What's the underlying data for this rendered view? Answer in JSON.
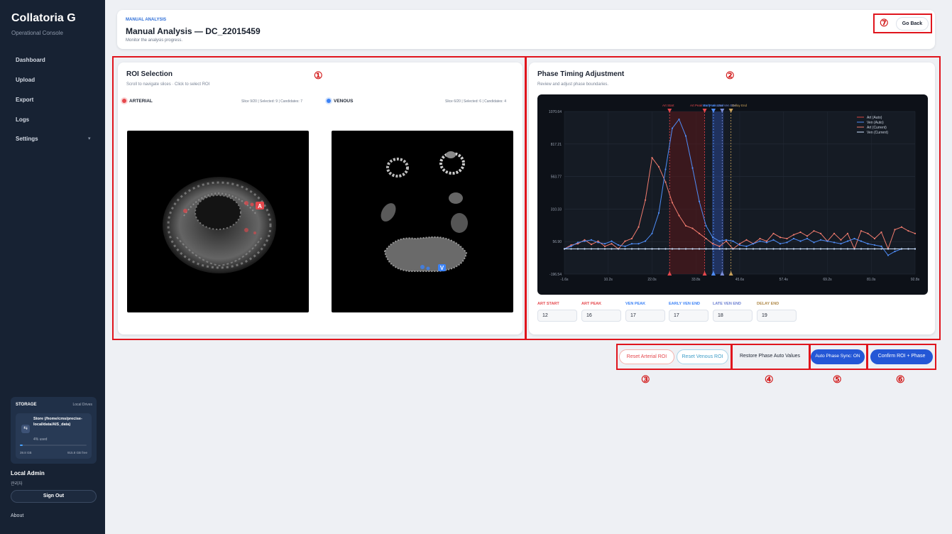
{
  "sidebar": {
    "brand": "Collatoria G",
    "subtitle": "Operational Console",
    "items": [
      {
        "label": "Dashboard"
      },
      {
        "label": "Upload"
      },
      {
        "label": "Export"
      },
      {
        "label": "Logs"
      },
      {
        "label": "Settings"
      }
    ],
    "storage": {
      "title": "STORAGE",
      "scope": "Local Drives",
      "name": "Store (/home/cms/precise-local/data/AIS_data)",
      "used_label": "4% used",
      "used_fraction": 0.04,
      "used": "39.8 GB",
      "free": "915.8 GB free"
    },
    "user": {
      "name": "Local Admin",
      "role": "관리자"
    },
    "sign_out": "Sign Out",
    "about": "About"
  },
  "header": {
    "eyebrow": "MANUAL ANALYSIS",
    "title": "Manual Analysis — DC_22015459",
    "subtitle": "Monitor the analysis progress.",
    "go_back": "Go Back"
  },
  "roi": {
    "title": "ROI Selection",
    "subtitle": "Scroll to navigate slices · Click to select ROI",
    "arterial": {
      "label": "ARTERIAL",
      "info": "Slice 9/20 | Selected: 9 | Candidates: 7",
      "marker": "A",
      "color": "#e5484d"
    },
    "venous": {
      "label": "VENOUS",
      "info": "Slice 6/20 | Selected: 6 | Candidates: 4",
      "marker": "V",
      "color": "#3b82f6"
    }
  },
  "phase": {
    "title": "Phase Timing Adjustment",
    "subtitle": "Review and adjust phase boundaries.",
    "fields": [
      {
        "label": "ART START",
        "value": "12",
        "color": "#e5484d"
      },
      {
        "label": "ART PEAK",
        "value": "16",
        "color": "#e5484d"
      },
      {
        "label": "VEN PEAK",
        "value": "17",
        "color": "#3b82f6"
      },
      {
        "label": "EARLY VEN END",
        "value": "17",
        "color": "#3b82f6"
      },
      {
        "label": "LATE VEN END",
        "value": "18",
        "color": "#6b7fd1"
      },
      {
        "label": "DELAY END",
        "value": "19",
        "color": "#b08a4a"
      }
    ]
  },
  "chart_data": {
    "type": "line",
    "title": "",
    "y_ticks": [
      "1070.64",
      "817.21",
      "563.77",
      "310.33",
      "56.90",
      "-196.54"
    ],
    "x_ticks": [
      "-1.6s",
      "10.2s",
      "22.0s",
      "33.8s",
      "45.6s",
      "57.4s",
      "69.2s",
      "81.0s",
      "92.8s"
    ],
    "ylim": [
      -196.54,
      1070.64
    ],
    "xlim": [
      -1.6,
      92.8
    ],
    "marker_labels": [
      "Art Start",
      "Art Peak",
      "Ven Peak",
      "Early Ven End",
      "Late Ven End",
      "Delay End"
    ],
    "legend": [
      "Art (Auto)",
      "Ven (Auto)",
      "Art (Current)",
      "Ven (Current)"
    ],
    "series": [
      {
        "name": "Art (Current)",
        "color": "#f07b6e",
        "values": [
          0,
          30,
          40,
          70,
          35,
          60,
          20,
          40,
          0,
          60,
          80,
          170,
          380,
          710,
          640,
          520,
          360,
          260,
          180,
          160,
          120,
          80,
          40,
          20,
          60,
          0,
          40,
          70,
          40,
          80,
          60,
          120,
          90,
          80,
          110,
          130,
          100,
          140,
          120,
          60,
          120,
          70,
          120,
          0,
          140,
          120,
          80,
          130,
          0,
          150,
          170,
          140,
          120
        ]
      },
      {
        "name": "Ven (Auto)",
        "color": "#4f8df7",
        "values": [
          0,
          20,
          50,
          60,
          70,
          50,
          40,
          60,
          30,
          20,
          40,
          40,
          60,
          120,
          280,
          620,
          940,
          1010,
          880,
          630,
          370,
          180,
          90,
          60,
          70,
          60,
          30,
          20,
          40,
          60,
          50,
          70,
          40,
          50,
          80,
          60,
          80,
          50,
          70,
          60,
          50,
          40,
          60,
          80,
          60,
          40,
          30,
          20,
          -50,
          -20,
          0,
          0,
          0
        ]
      },
      {
        "name": "Ven (Current)",
        "color": "#cfe3ff",
        "values": [
          0,
          0,
          0,
          0,
          0,
          0,
          0,
          0,
          0,
          0,
          0,
          0,
          0,
          0,
          0,
          0,
          0,
          0,
          0,
          0,
          0,
          0,
          0,
          0,
          0,
          0,
          0,
          0,
          0,
          0,
          0,
          0,
          0,
          0,
          0,
          0,
          0,
          0,
          0,
          0,
          0,
          0,
          0,
          0,
          0,
          0,
          0,
          0,
          0,
          0,
          0,
          0,
          0
        ]
      }
    ]
  },
  "actions": {
    "reset_arterial": "Reset Arterial ROI",
    "reset_venous": "Reset Venous ROI",
    "restore": "Restore Phase Auto Values",
    "sync": "Auto Phase Sync: ON",
    "confirm": "Confirm ROI + Phase"
  },
  "annotations": [
    "①",
    "②",
    "③",
    "④",
    "⑤",
    "⑥",
    "⑦"
  ]
}
